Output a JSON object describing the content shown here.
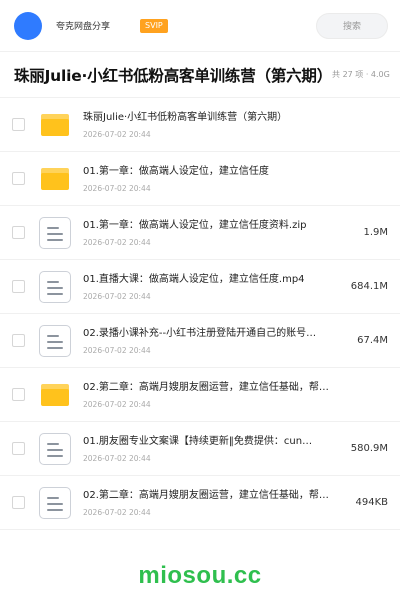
{
  "header": {
    "user_name": "夸克网盘分享",
    "badge": "SVIP",
    "search_placeholder": "搜索"
  },
  "folder": {
    "title": "珠丽Julie·小红书低粉高客单训练营（第六期）",
    "meta": "共 27 项 · 4.0G"
  },
  "items": [
    {
      "type": "folder",
      "name": "珠丽Julie·小红书低粉高客单训练营（第六期）",
      "date": "2026-07-02 20:44",
      "size": ""
    },
    {
      "type": "folder",
      "name": "01.第一章：做高端人设定位，建立信任度",
      "date": "2026-07-02 20:44",
      "size": ""
    },
    {
      "type": "file",
      "name": "01.第一章：做高端人设定位，建立信任度资料.zip",
      "date": "2026-07-02 20:44",
      "size": "1.9M"
    },
    {
      "type": "file",
      "name": "01.直播大课：做高端人设定位，建立信任度.mp4",
      "date": "2026-07-02 20:44",
      "size": "684.1M"
    },
    {
      "type": "file",
      "name": "02.录播小课补充--小红书注册登陆开通自己的账号…",
      "date": "2026-07-02 20:44",
      "size": "67.4M"
    },
    {
      "type": "folder",
      "name": "02.第二章：高端月嫂朋友圈运营，建立信任基础，帮…",
      "date": "2026-07-02 20:44",
      "size": ""
    },
    {
      "type": "file",
      "name": "01.朋友圈专业文案课【持续更新‖免费提供：cun…",
      "date": "2026-07-02 20:44",
      "size": "580.9M"
    },
    {
      "type": "file",
      "name": "02.第二章：高端月嫂朋友圈运营，建立信任基础，帮…",
      "date": "2026-07-02 20:44",
      "size": "494KB"
    }
  ],
  "watermark": "miosou.cc",
  "colors": {
    "avatar": "#2f7bff",
    "badge": "#ffa21f",
    "folder": "#ffc21c",
    "watermark": "#2fbf4e"
  }
}
